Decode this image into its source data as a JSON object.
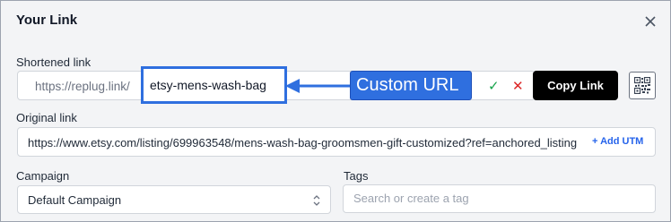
{
  "modal": {
    "title": "Your Link"
  },
  "shortened": {
    "label": "Shortened link",
    "prefix": "https://replug.link/",
    "value": "etsy-mens-wash-bag",
    "callout": "Custom URL",
    "copy_label": "Copy Link"
  },
  "original": {
    "label": "Original link",
    "value": "https://www.etsy.com/listing/699963548/mens-wash-bag-groomsmen-gift-customized?ref=anchored_listing",
    "utm_label": "+ Add UTM"
  },
  "campaign": {
    "label": "Campaign",
    "selected": "Default Campaign"
  },
  "tags": {
    "label": "Tags",
    "placeholder": "Search or create a tag"
  },
  "colors": {
    "accent": "#2f6fdf",
    "confirm": "#16a34a",
    "cancel": "#dc2626"
  },
  "icons": {
    "close": "close-icon",
    "confirm": "check-icon",
    "cancel": "x-icon",
    "qr": "qr-code-icon",
    "select": "chevron-updown-icon"
  }
}
